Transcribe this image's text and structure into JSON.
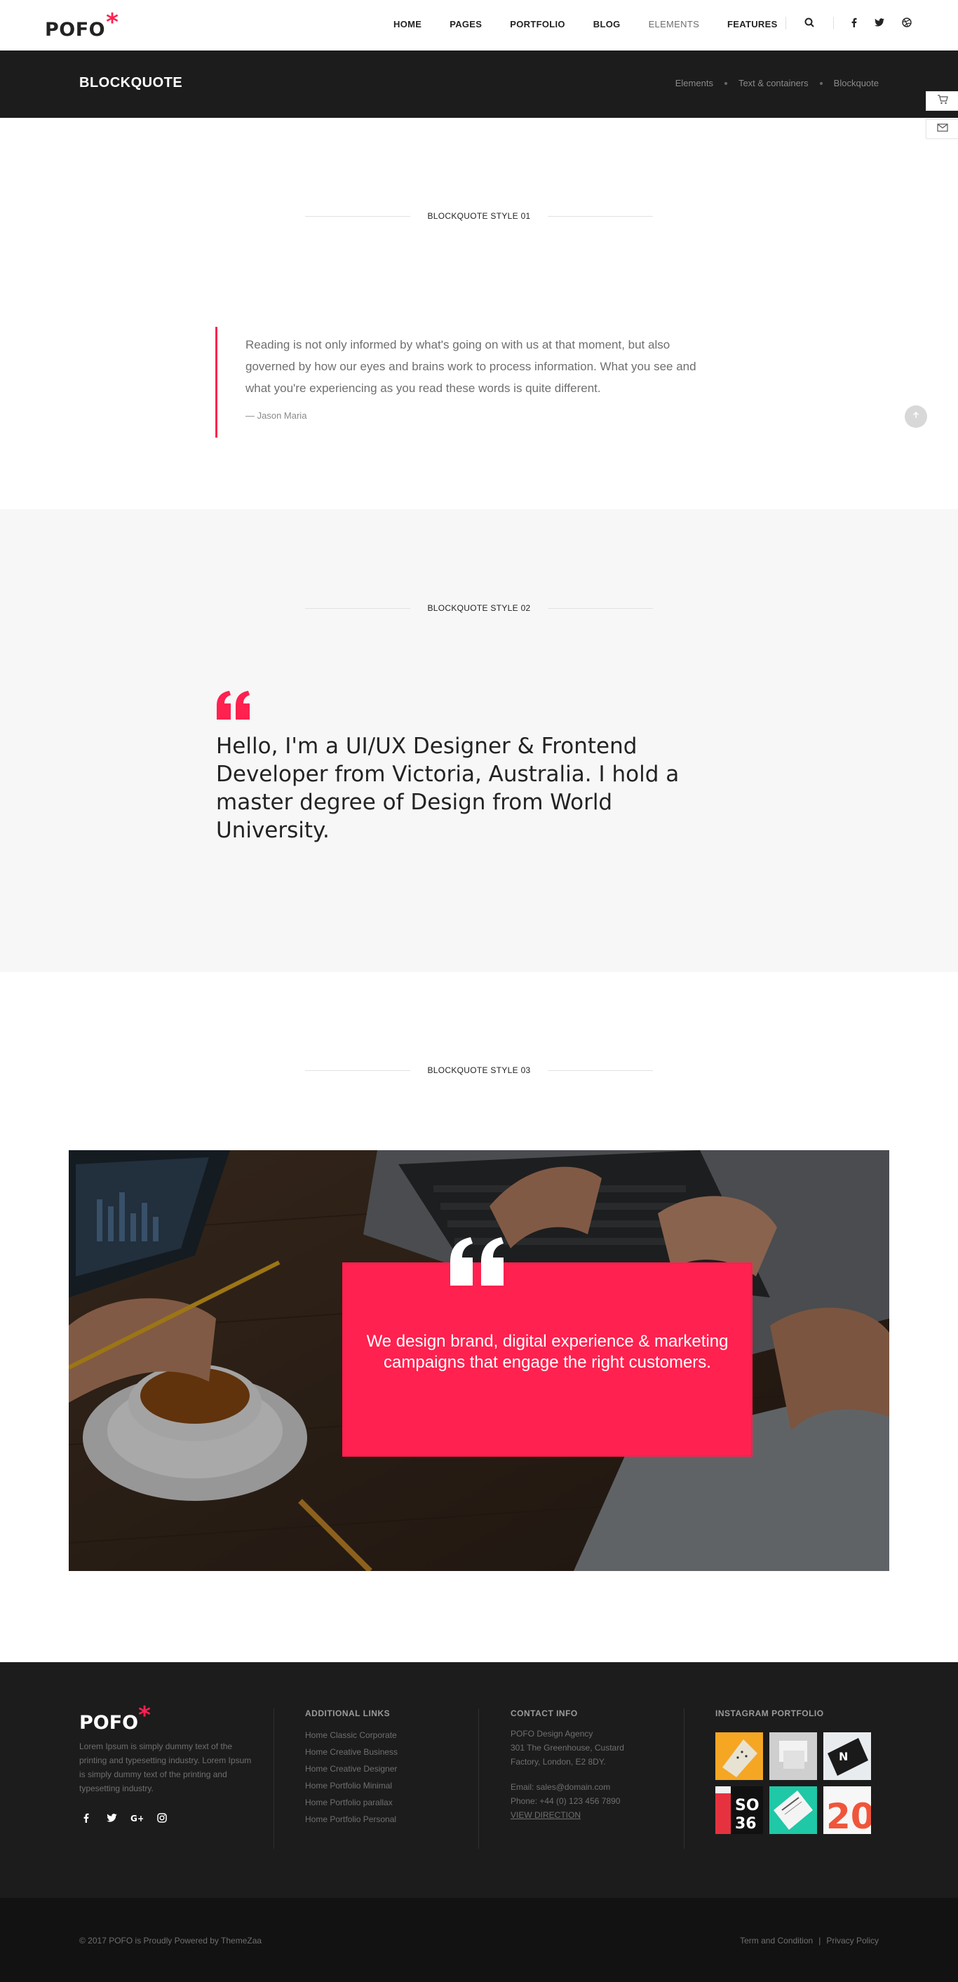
{
  "header": {
    "logo": "POFO",
    "logo_mark": "*",
    "nav": [
      "HOME",
      "PAGES",
      "PORTFOLIO",
      "BLOG",
      "ELEMENTS",
      "FEATURES"
    ],
    "icons": [
      "search-icon",
      "facebook-icon",
      "twitter-icon",
      "dribbble-icon"
    ]
  },
  "title_bar": {
    "title": "BLOCKQUOTE",
    "breadcrumb": [
      "Elements",
      "Text & containers",
      "Blockquote"
    ]
  },
  "side_buttons": [
    "cart-icon",
    "mail-icon"
  ],
  "style01": {
    "heading": "BLOCKQUOTE STYLE 01",
    "quote": "Reading is not only informed by what's going on with us at that moment, but also governed by how our eyes and brains work to process information. What you see and what you're experiencing as you read these words is quite different.",
    "author": "— Jason Maria"
  },
  "style02": {
    "heading": "BLOCKQUOTE STYLE 02",
    "quote": "Hello, I'm a UI/UX Designer & Frontend Developer from Victoria, Australia. I hold a master degree of Design from World University."
  },
  "style03": {
    "heading": "BLOCKQUOTE STYLE 03",
    "quote": "We design brand, digital experience & marketing campaigns that engage the right customers."
  },
  "footer": {
    "logo": "POFO",
    "logo_mark": "*",
    "about": "Lorem Ipsum is simply dummy text of the printing and typesetting industry. Lorem Ipsum is simply dummy text of the printing and typesetting industry.",
    "links_heading": "ADDITIONAL LINKS",
    "links": [
      "Home Classic Corporate",
      "Home Creative Business",
      "Home Creative Designer",
      "Home Portfolio Minimal",
      "Home Portfolio parallax",
      "Home Portfolio Personal"
    ],
    "contact_heading": "CONTACT INFO",
    "contact_name": "POFO Design Agency",
    "contact_address": "301 The Greenhouse, Custard Factory, London, E2 8DY.",
    "contact_email": "Email: sales@domain.com",
    "contact_phone": "Phone: +44 (0) 123 456 7890",
    "contact_direction": "VIEW DIRECTION",
    "instagram_heading": "INSTAGRAM PORTFOLIO",
    "copyright": "© 2017 POFO is Proudly Powered by ThemeZaa",
    "terms": "Term and Condition",
    "privacy": "Privacy Policy",
    "legal_sep": "|"
  },
  "colors": {
    "accent": "#ff214f",
    "dark": "#1c1c1c",
    "section_bg": "#f7f7f7"
  }
}
